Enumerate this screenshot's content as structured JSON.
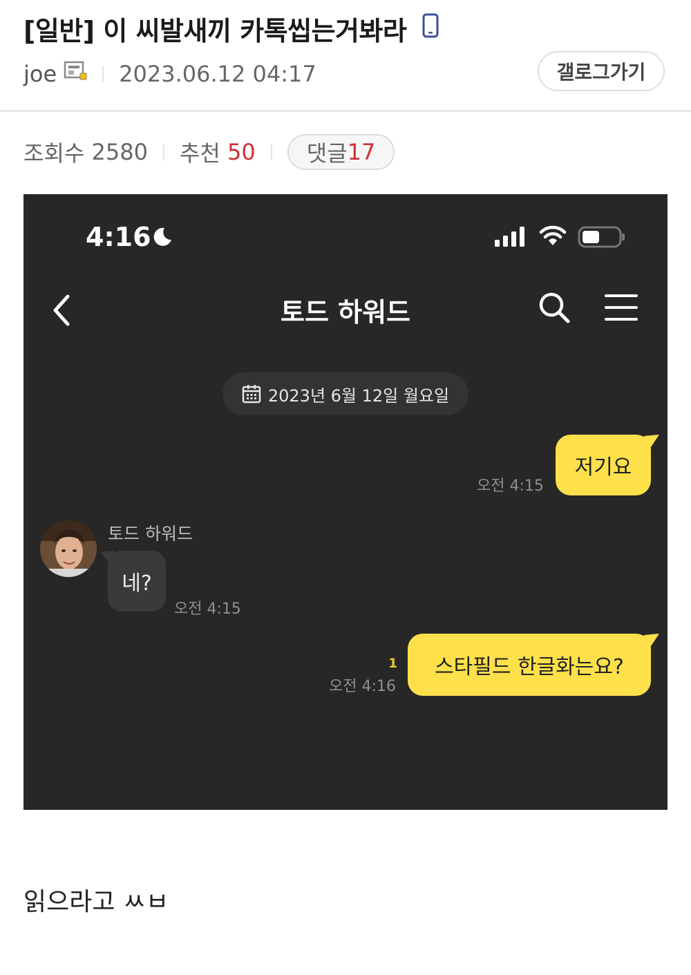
{
  "post": {
    "category": "[일반]",
    "title": "이 씨발새끼 카톡씹는거봐라",
    "author": "joe",
    "datetime": "2023.06.12 04:17",
    "gallery_button": "갤로그가기",
    "views_label": "조회수",
    "views": "2580",
    "recommend_label": "추천",
    "recommend": "50",
    "comments_label": "댓글",
    "comments": "17",
    "body": "읽으라고 ㅆㅂ",
    "accent_color": "#d0302e"
  },
  "screenshot": {
    "status_time": "4:16",
    "chat_title": "토드 하워드",
    "date_label": "2023년 6월 12일 월요일",
    "messages": [
      {
        "side": "me",
        "text": "저기요",
        "time": "오전 4:15"
      },
      {
        "side": "other",
        "sender": "토드 하워드",
        "text": "네?",
        "time": "오전 4:15"
      },
      {
        "side": "me",
        "text": "스타필드 한글화는요?",
        "time": "오전 4:16",
        "unread": "1"
      }
    ],
    "bubble_color": "#fde04a",
    "background_color": "#272727"
  }
}
